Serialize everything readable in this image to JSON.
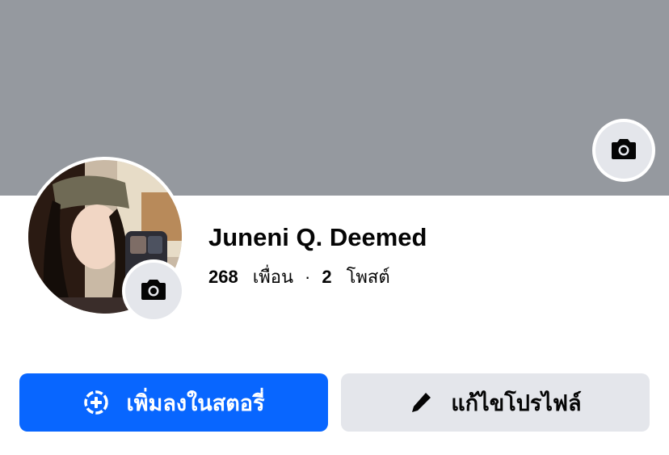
{
  "profile": {
    "name": "Juneni Q. Deemed",
    "friends_count": "268",
    "friends_label": "เพื่อน",
    "separator": "·",
    "posts_count": "2",
    "posts_label": "โพสต์"
  },
  "actions": {
    "add_story_label": "เพิ่มลงในสตอรี่",
    "edit_profile_label": "แก้ไขโปรไฟล์"
  },
  "icons": {
    "cover_camera": "camera-icon",
    "avatar_camera": "camera-icon",
    "add_story": "plus-circle-icon",
    "edit_profile": "pencil-icon"
  },
  "colors": {
    "cover_bg": "#95999f",
    "primary_blue": "#0866ff",
    "secondary_gray": "#e4e6eb",
    "text": "#050505"
  }
}
